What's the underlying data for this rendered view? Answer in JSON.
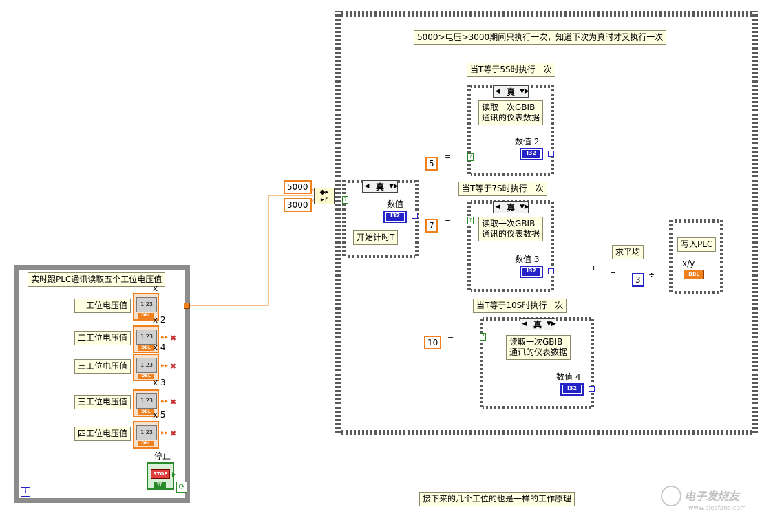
{
  "left_loop": {
    "title": "实时跟PLC通讯读取五个工位电压值",
    "controls": [
      {
        "label": "一工位电压值",
        "index": "x",
        "multiplier": "2"
      },
      {
        "label": "二工位电压值",
        "index": "",
        "multiplier": "4"
      },
      {
        "label": "三工位电压值",
        "index": "",
        "multiplier": "3"
      },
      {
        "label": "三工位电压值",
        "index": "",
        "multiplier": "5"
      },
      {
        "label": "四工位电压值",
        "index": "",
        "multiplier": ""
      }
    ],
    "knob_text": "1.23",
    "dbl_tag": "DBL",
    "stop_label": "停止",
    "stop_button": "STOP",
    "stop_tag": "TF",
    "iteration": "i"
  },
  "compare": {
    "upper": "5000",
    "lower": "3000"
  },
  "outer_case": {
    "note": "5000>电压>3000期间只执行一次，知道下次为真时才又执行一次",
    "selector": "真"
  },
  "timer_case": {
    "selector": "真",
    "value_label": "数值",
    "body": "开始计时T",
    "i32": "I32"
  },
  "case_5s": {
    "title": "当T等于5S时执行一次",
    "selector": "真",
    "body_line1": "读取一次GBIB",
    "body_line2": "通讯的仪表数据",
    "value_label": "数值 2",
    "const": "5",
    "i32": "I32"
  },
  "case_7s": {
    "title": "当T等于7S时执行一次",
    "selector": "真",
    "body_line1": "读取一次GBIB",
    "body_line2": "通讯的仪表数据",
    "value_label": "数值 3",
    "const": "7",
    "i32": "I32"
  },
  "case_10s": {
    "title": "当T等于10S时执行一次",
    "selector": "真",
    "body_line1": "读取一次GBIB",
    "body_line2": "通讯的仪表数据",
    "value_label": "数值 4",
    "const": "10",
    "i32": "I32"
  },
  "average": {
    "label": "求平均",
    "divisor": "3",
    "plus": "+",
    "eq": "="
  },
  "write_plc": {
    "label": "写入PLC",
    "xy": "x/y",
    "dbl": "DBL"
  },
  "footer_note": "接下来的几个工位的也是一样的工作原理",
  "watermark": {
    "brand": "电子发烧友",
    "url": "www.elecfans.com"
  },
  "colors": {
    "wire_orange": "#f07f1e",
    "wire_blue": "#2323c8",
    "wire_green": "#2a8a2a",
    "note_bg": "#ffffe1"
  }
}
